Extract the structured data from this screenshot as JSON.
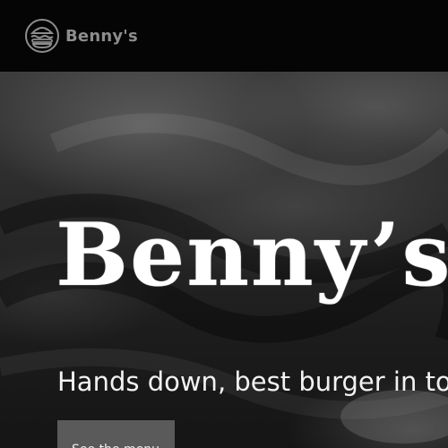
{
  "header": {
    "brand_name": "Benny's",
    "logo_icon": "burger-icon",
    "brand_color": "#8c8c8c",
    "background_color": "#050505"
  },
  "hero": {
    "title": "Benny’s",
    "tagline": "Hands down, best burger in to",
    "cta_label": "See the menu",
    "cta_color": "#5a5a5a"
  }
}
